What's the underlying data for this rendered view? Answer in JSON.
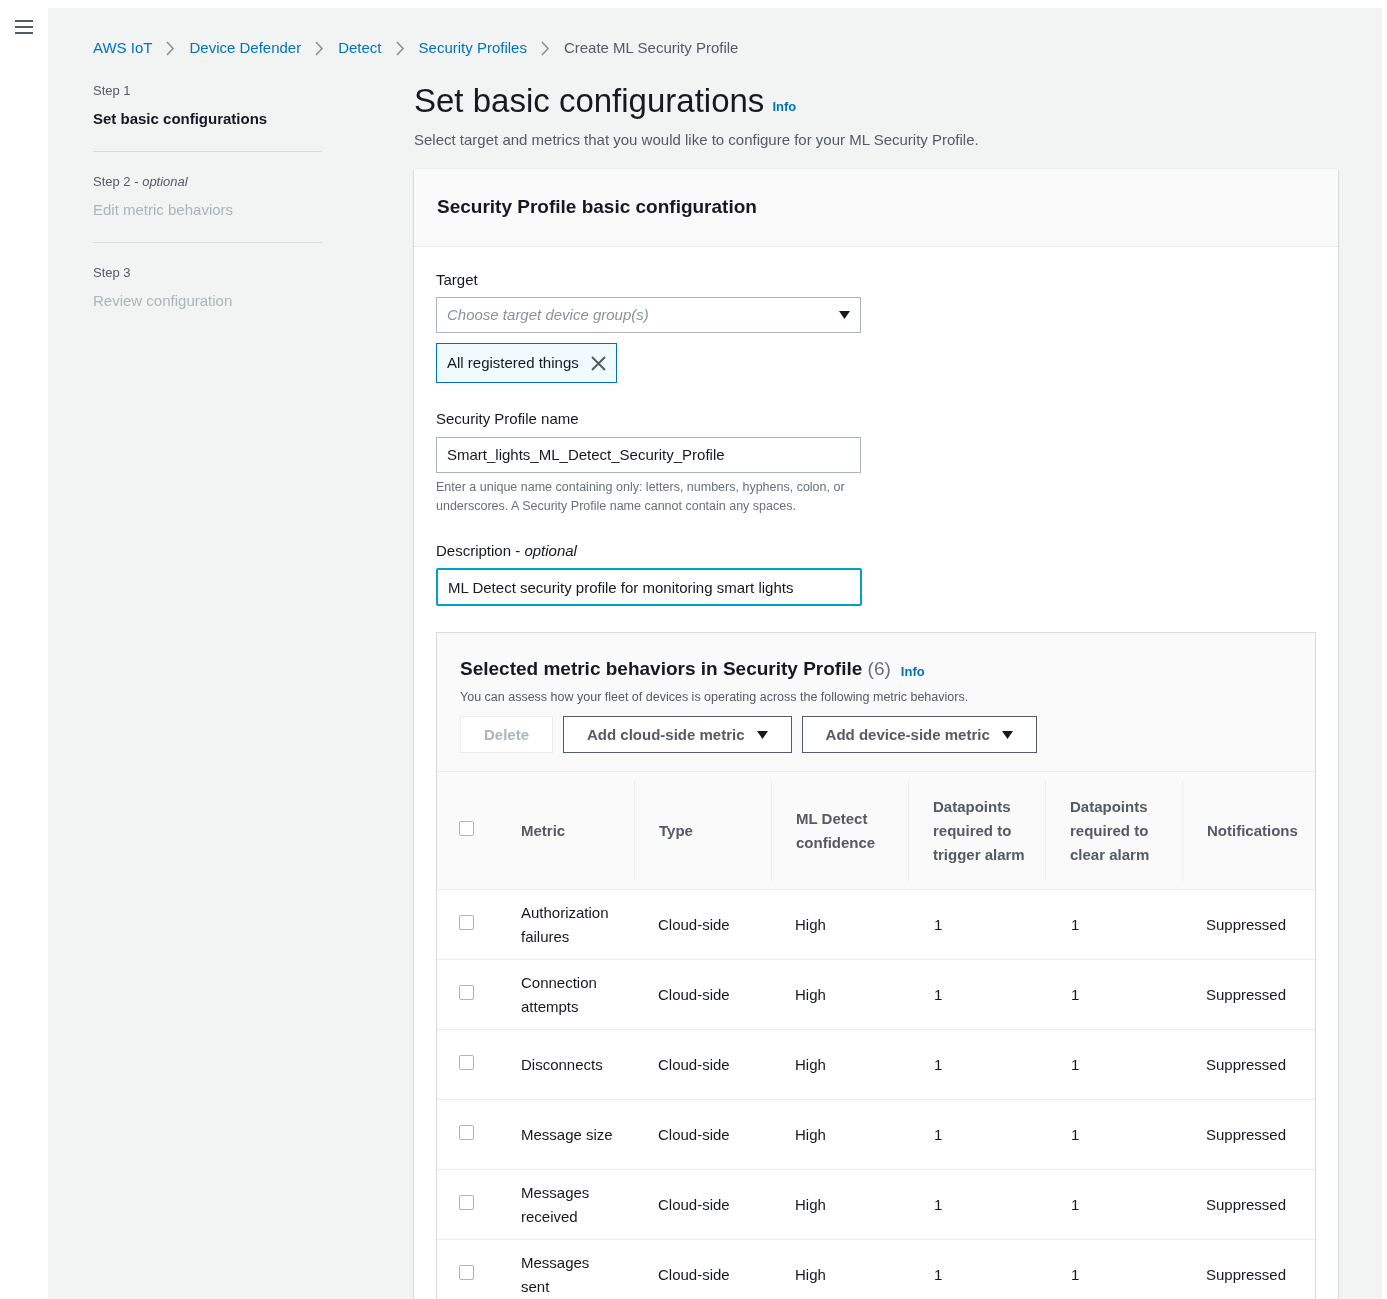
{
  "breadcrumbs": [
    {
      "label": "AWS IoT",
      "link": true
    },
    {
      "label": "Device Defender",
      "link": true
    },
    {
      "label": "Detect",
      "link": true
    },
    {
      "label": "Security Profiles",
      "link": true
    },
    {
      "label": "Create ML Security Profile",
      "link": false
    }
  ],
  "steps": [
    {
      "step": "Step 1",
      "title": "Set basic configurations",
      "selected": true
    },
    {
      "step": "Step 2 -",
      "optional": "optional",
      "title": "Edit metric behaviors",
      "selected": false
    },
    {
      "step": "Step 3",
      "title": "Review configuration",
      "selected": false
    }
  ],
  "page": {
    "title": "Set basic configurations",
    "info": "Info",
    "subtitle": "Select target and metrics that you would like to configure for your ML Security Profile."
  },
  "config_panel": {
    "title": "Security Profile basic configuration",
    "target": {
      "label": "Target",
      "placeholder": "Choose target device group(s)",
      "token": "All registered things"
    },
    "name": {
      "label": "Security Profile name",
      "value": "Smart_lights_ML_Detect_Security_Profile",
      "hint": "Enter a unique name containing only: letters, numbers, hyphens, colon, or underscores. A Security Profile name cannot contain any spaces."
    },
    "description": {
      "label": "Description -",
      "optional": "optional",
      "value": "ML Detect security profile for monitoring smart lights",
      "focused": true
    }
  },
  "metrics": {
    "title": "Selected metric behaviors in Security Profile",
    "count": "(6)",
    "info": "Info",
    "subtitle": "You can assess how your fleet of devices is operating across the following metric behaviors.",
    "buttons": [
      {
        "label": "Delete",
        "disabled": true,
        "dropdown": false
      },
      {
        "label": "Add cloud-side metric",
        "disabled": false,
        "dropdown": true
      },
      {
        "label": "Add device-side metric",
        "disabled": false,
        "dropdown": true
      }
    ],
    "select_all": {
      "checked": false
    },
    "columns": [
      "Metric",
      "Type",
      "ML Detect confidence",
      "Datapoints required to trigger alarm",
      "Datapoints required to clear alarm",
      "Notifications"
    ],
    "rows": [
      {
        "checked": false,
        "cells": [
          "Authorization failures",
          "Cloud-side",
          "High",
          "1",
          "1",
          "Suppressed"
        ]
      },
      {
        "checked": false,
        "cells": [
          "Connection attempts",
          "Cloud-side",
          "High",
          "1",
          "1",
          "Suppressed"
        ]
      },
      {
        "checked": false,
        "cells": [
          "Disconnects",
          "Cloud-side",
          "High",
          "1",
          "1",
          "Suppressed"
        ]
      },
      {
        "checked": false,
        "cells": [
          "Message size",
          "Cloud-side",
          "High",
          "1",
          "1",
          "Suppressed"
        ]
      },
      {
        "checked": false,
        "cells": [
          "Messages received",
          "Cloud-side",
          "High",
          "1",
          "1",
          "Suppressed"
        ]
      },
      {
        "checked": false,
        "cells": [
          "Messages sent",
          "Cloud-side",
          "High",
          "1",
          "1",
          "Suppressed"
        ]
      }
    ]
  }
}
